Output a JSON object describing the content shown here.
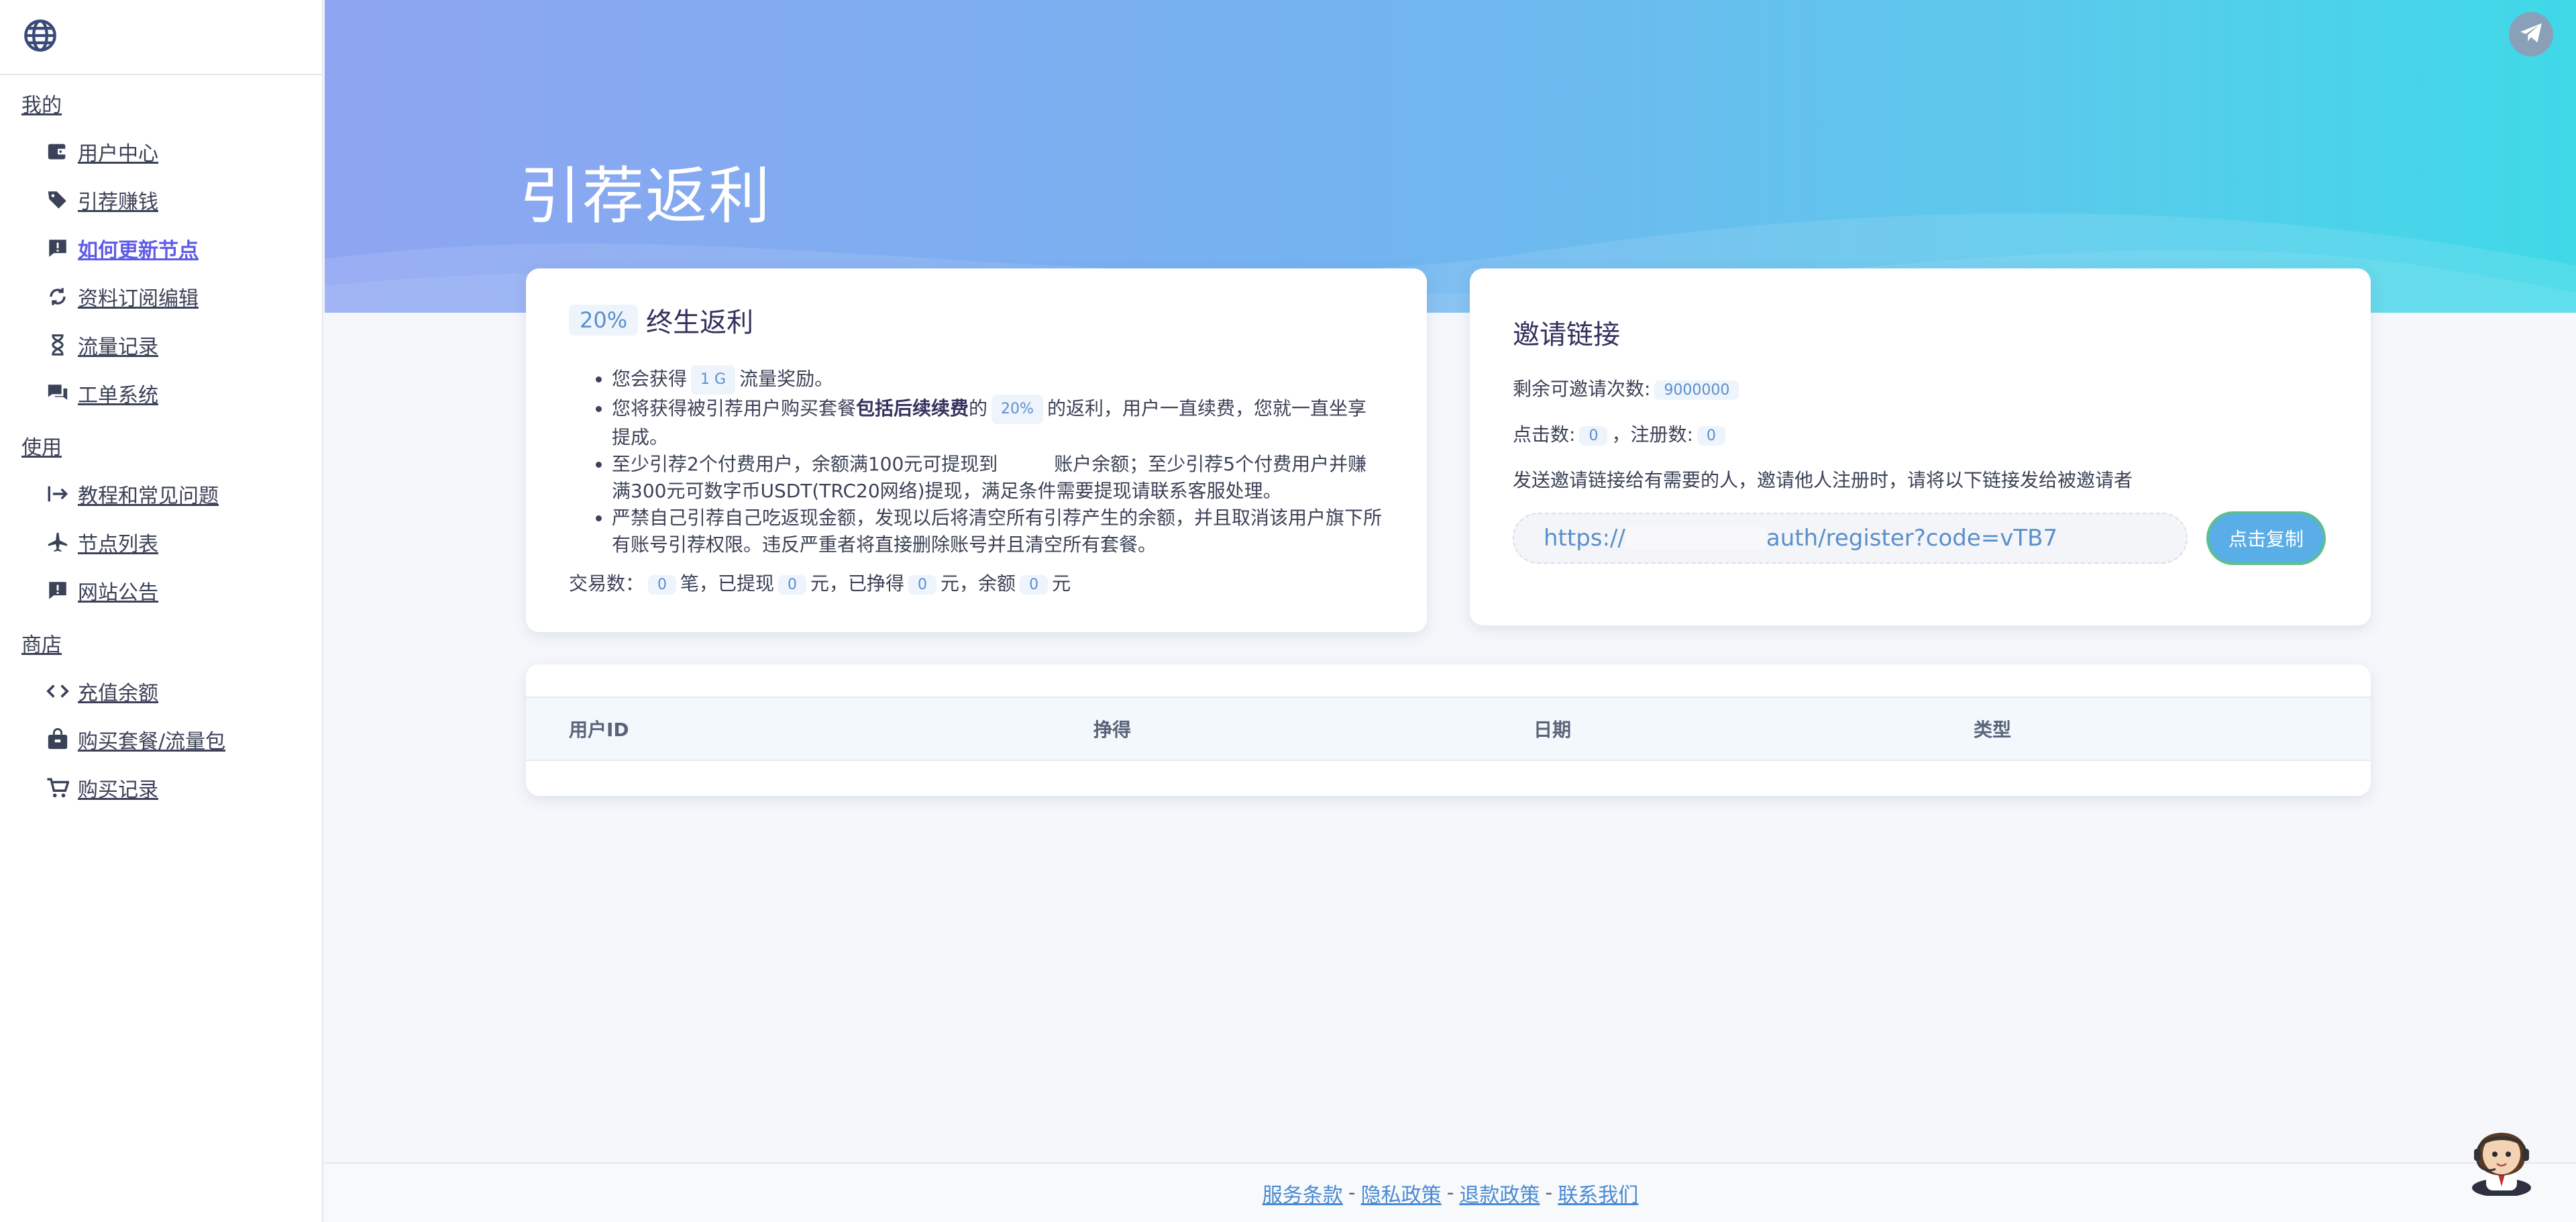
{
  "sidebar": {
    "sections": [
      {
        "title": "我的",
        "items": [
          {
            "label": "用户中心",
            "icon": "wallet-icon"
          },
          {
            "label": "引荐赚钱",
            "icon": "tags-icon"
          },
          {
            "label": "如何更新节点",
            "icon": "alert-message-icon",
            "active": true
          },
          {
            "label": "资料订阅编辑",
            "icon": "sync-icon"
          },
          {
            "label": "流量记录",
            "icon": "hourglass-icon"
          },
          {
            "label": "工单系统",
            "icon": "chat-icon"
          }
        ]
      },
      {
        "title": "使用",
        "items": [
          {
            "label": "教程和常见问题",
            "icon": "sign-in-icon"
          },
          {
            "label": "节点列表",
            "icon": "plane-icon"
          },
          {
            "label": "网站公告",
            "icon": "announcement-icon"
          }
        ]
      },
      {
        "title": "商店",
        "items": [
          {
            "label": "充值余额",
            "icon": "code-icon"
          },
          {
            "label": "购买套餐/流量包",
            "icon": "shopping-bag-icon"
          },
          {
            "label": "购买记录",
            "icon": "cart-icon"
          }
        ]
      }
    ]
  },
  "hero": {
    "title": "引荐返利"
  },
  "rebate": {
    "percent": "20%",
    "title": "终生返利",
    "l1_a": "您会获得",
    "l1_chip": "1 G",
    "l1_b": "流量奖励。",
    "l2_a": "您将获得被引荐用户购买套餐",
    "l2_bold": "包括后续续费",
    "l2_b": "的",
    "l2_chip": "20%",
    "l2_c": "的返利，用户一直续费，您就一直坐享提成。",
    "l3": "至少引荐2个付费用户，余额满100元可提现到　　　账户余额；至少引荐5个付费用户并赚满300元可数字币USDT(TRC20网络)提现，满足条件需要提现请联系客服处理。",
    "l4": "严禁自己引荐自己吃返现金额，发现以后将清空所有引荐产生的余额，并且取消该用户旗下所有账号引荐权限。违反严重者将直接删除账号并且清空所有套餐。",
    "stats": {
      "l_trades": "交易数：",
      "trades": "0",
      "l_withdrawn": "笔，已提现",
      "withdrawn": "0",
      "l_earned": "元，已挣得",
      "earned": "0",
      "l_balance": "元，余额",
      "balance": "0",
      "l_unit": "元"
    }
  },
  "invite": {
    "title": "邀请链接",
    "remaining_label": "剩余可邀请次数:",
    "remaining": "9000000",
    "clicks_label": "点击数:",
    "clicks": "0",
    "reg_label": "，注册数:",
    "registrations": "0",
    "desc": "发送邀请链接给有需要的人，邀请他人注册时，请将以下链接发给被邀请者",
    "link_prefix": "https://",
    "link_suffix": "auth/register?code=vTB7",
    "copy_label": "点击复制"
  },
  "table": {
    "columns": [
      "用户ID",
      "挣得",
      "日期",
      "类型"
    ]
  },
  "footer": {
    "links": [
      "服务条款",
      "隐私政策",
      "退款政策",
      "联系我们"
    ],
    "separator": "-"
  },
  "colors": {
    "accent": "#5e5ce6",
    "link": "#4a8ad4",
    "copy_button": "#5aaee8"
  }
}
